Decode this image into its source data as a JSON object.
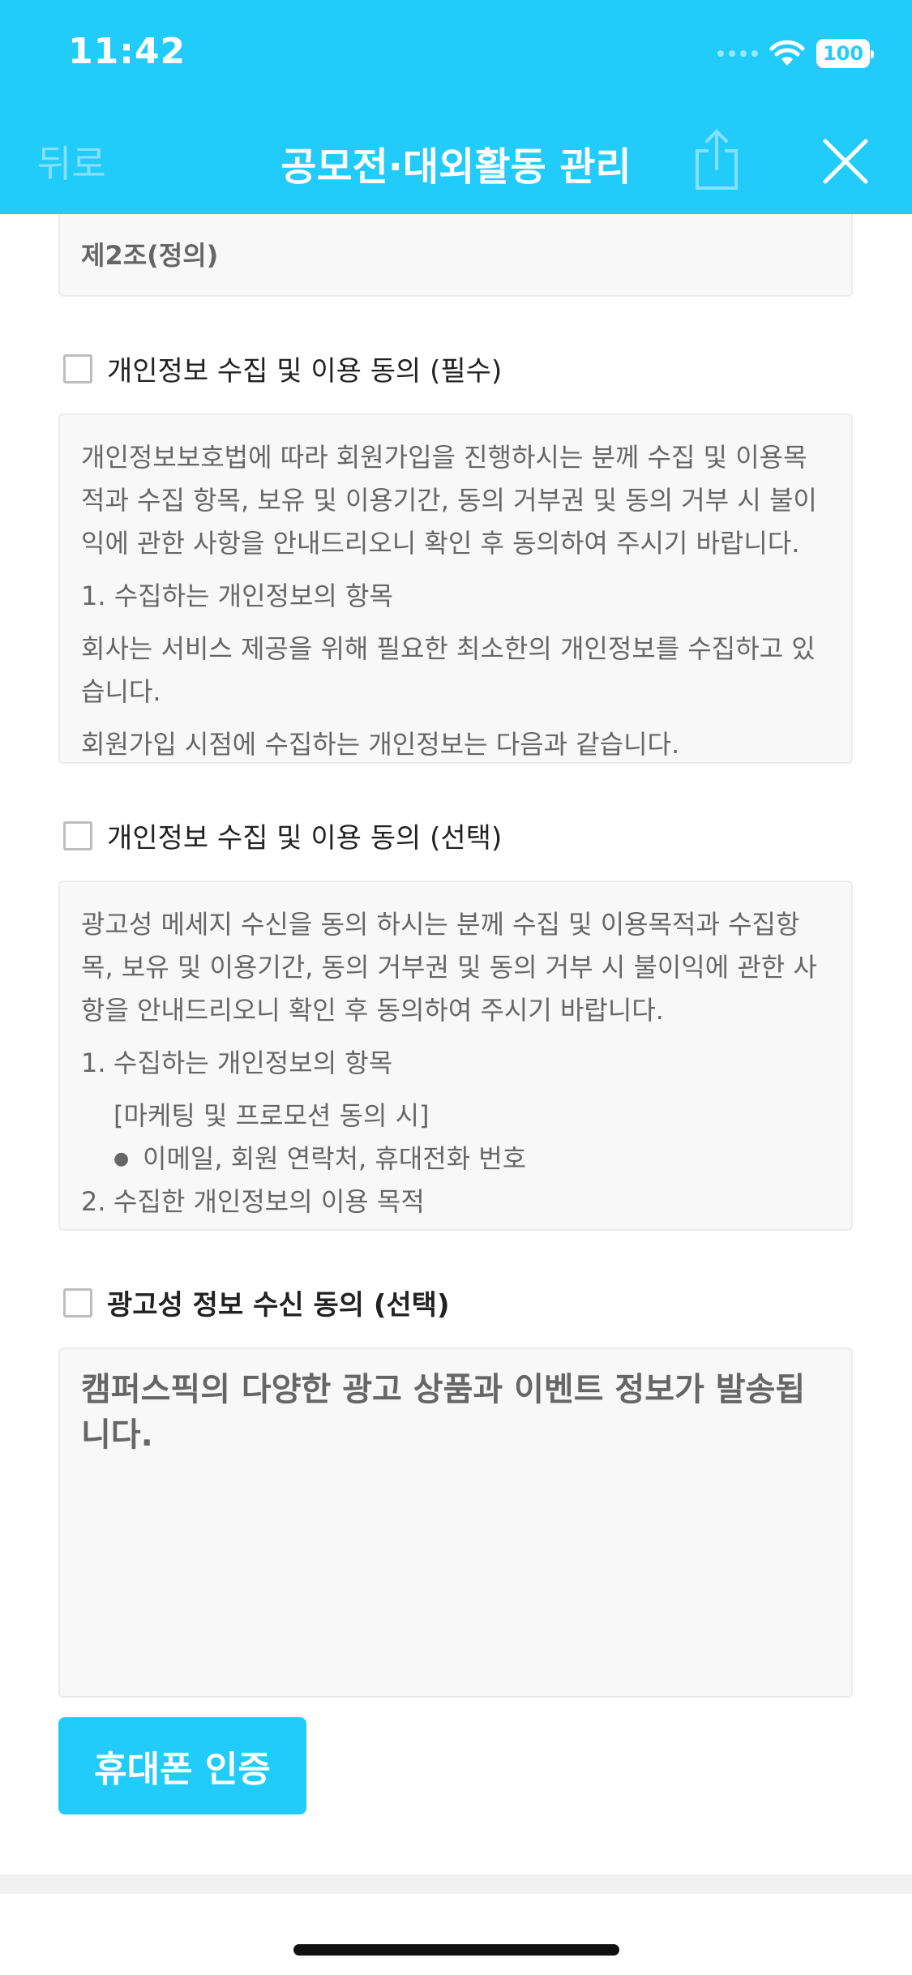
{
  "status_bar": {
    "time": "11:42",
    "battery": "100"
  },
  "nav": {
    "back_label": "뒤로",
    "title": "공모전·대외활동 관리"
  },
  "section_article": {
    "title": "제2조(정의)"
  },
  "consent_required": {
    "label": "개인정보 수집 및 이용 동의 (필수)",
    "paragraphs": [
      "개인정보보호법에 따라 회원가입을 진행하시는 분께 수집 및 이용목적과 수집 항목, 보유 및 이용기간, 동의 거부권 및 동의 거부 시 불이익에 관한 사항을 안내드리오니 확인 후 동의하여 주시기 바랍니다.",
      "1. 수집하는 개인정보의 항목",
      "회사는 서비스 제공을 위해 필요한 최소한의 개인정보를 수집하고 있습니다.",
      "회원가입 시점에 수집하는 개인정보는 다음과 같습니다."
    ]
  },
  "consent_optional": {
    "label": "개인정보 수집 및 이용 동의 (선택)",
    "intro": "광고성 메세지 수신을 동의 하시는 분께 수집 및 이용목적과 수집항목, 보유 및 이용기간, 동의 거부권 및 동의 거부 시 불이익에 관한 사항을 안내드리오니 확인 후 동의하여 주시기 바랍니다.",
    "item1_num": "1.",
    "item1": "수집하는 개인정보의 항목",
    "item1_sub": "[마케팅 및 프로모션 동의 시]",
    "item1_bullet": "이메일, 회원 연락처, 휴대전화 번호",
    "item2_num": "2.",
    "item2": "수집한 개인정보의 이용 목적"
  },
  "consent_ads": {
    "label": "광고성 정보 수신 동의 (선택)",
    "text": "캠퍼스픽의 다양한 광고 상품과 이벤트 정보가 발송됩니다."
  },
  "cta": {
    "label": "휴대폰 인증"
  },
  "colors": {
    "brand": "#21CBFA",
    "box_bg": "#f8f8f8",
    "text_muted": "#666666"
  }
}
